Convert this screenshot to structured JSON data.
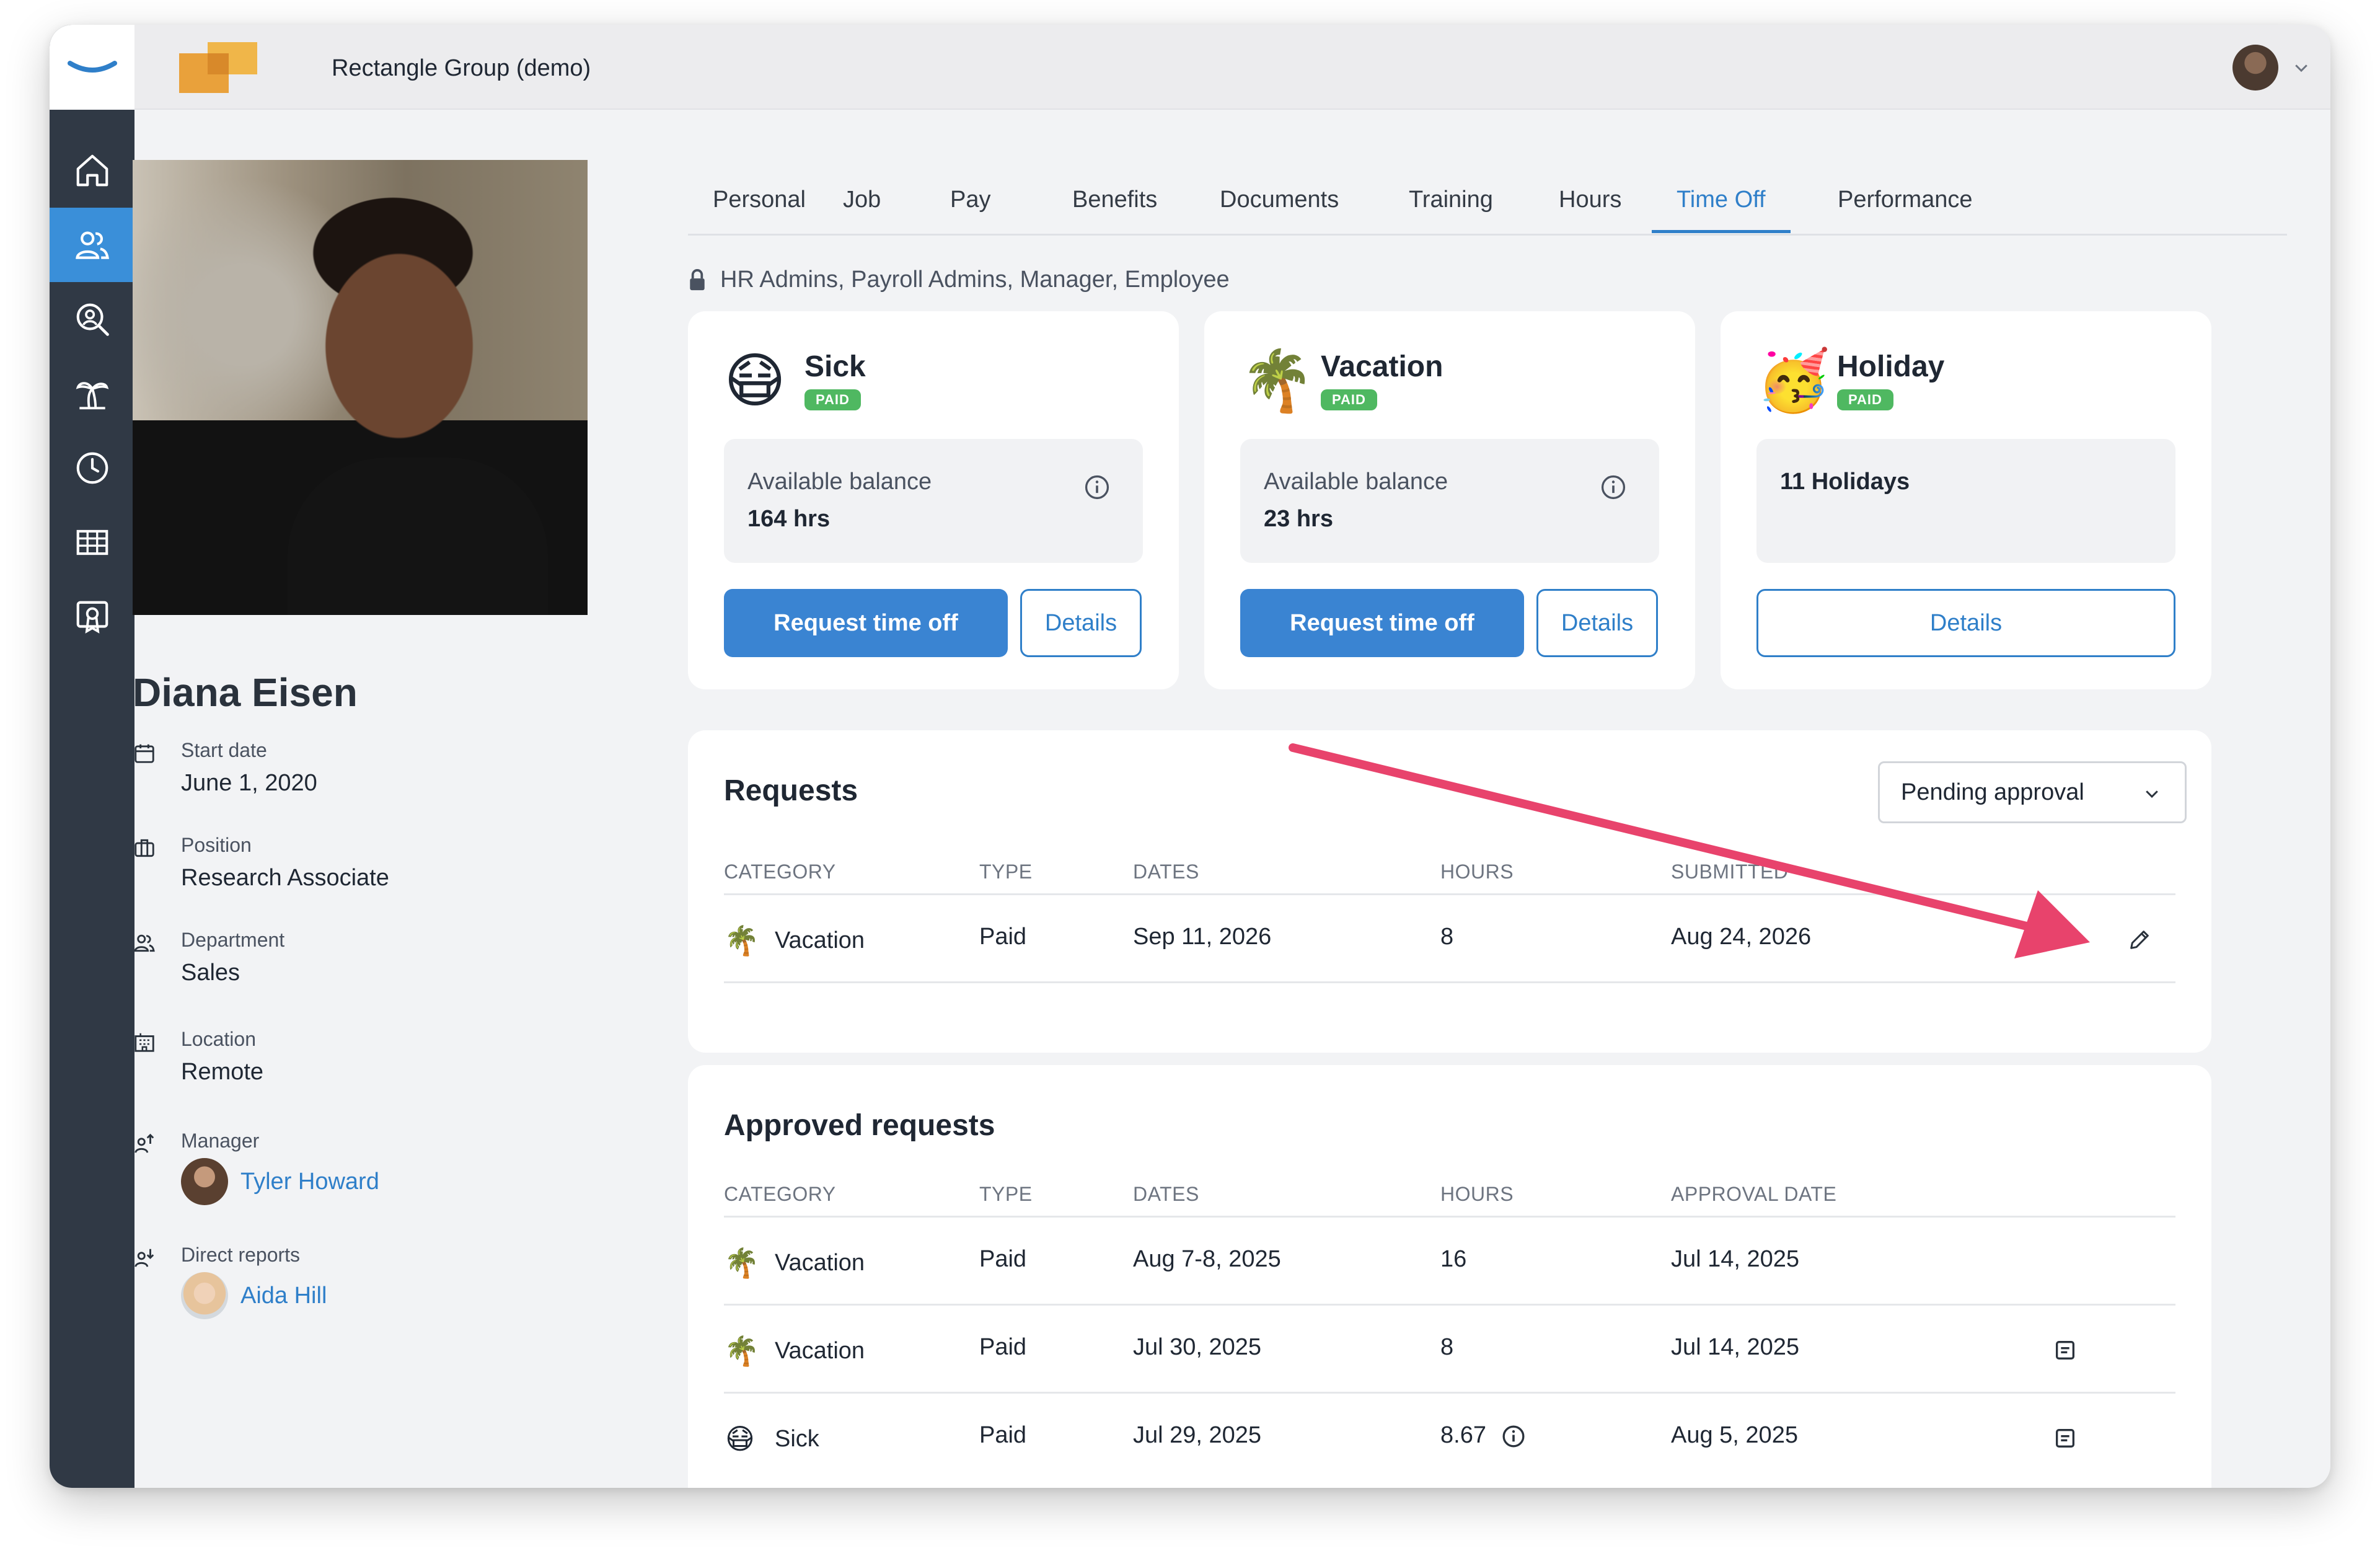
{
  "company": {
    "name": "Rectangle Group (demo)"
  },
  "sidebar": {
    "items": [
      {
        "label": "home",
        "icon": "home-icon"
      },
      {
        "label": "people",
        "icon": "people-icon",
        "active": true
      },
      {
        "label": "search",
        "icon": "user-search-icon"
      },
      {
        "label": "time off",
        "icon": "palm-tree-icon"
      },
      {
        "label": "time",
        "icon": "clock-icon"
      },
      {
        "label": "reports",
        "icon": "table-icon"
      },
      {
        "label": "training",
        "icon": "certificate-icon"
      }
    ]
  },
  "profile": {
    "name": "Diana Eisen",
    "start_date_label": "Start date",
    "start_date": "June 1, 2020",
    "position_label": "Position",
    "position": "Research Associate",
    "department_label": "Department",
    "department": "Sales",
    "location_label": "Location",
    "location": "Remote",
    "manager_label": "Manager",
    "manager": "Tyler Howard",
    "direct_reports_label": "Direct reports",
    "direct_report": "Aida Hill"
  },
  "tabs": [
    "Personal",
    "Job",
    "Pay",
    "Benefits",
    "Documents",
    "Training",
    "Hours",
    "Time Off",
    "Performance"
  ],
  "active_tab": "Time Off",
  "permissions": "HR Admins, Payroll Admins, Manager, Employee",
  "policies": [
    {
      "title": "Sick",
      "badge": "PAID",
      "emoji": "😷",
      "balance_label": "Available balance",
      "balance": "164 hrs",
      "request_label": "Request time off",
      "details_label": "Details"
    },
    {
      "title": "Vacation",
      "badge": "PAID",
      "emoji": "🌴",
      "balance_label": "Available balance",
      "balance": "23 hrs",
      "request_label": "Request time off",
      "details_label": "Details"
    },
    {
      "title": "Holiday",
      "badge": "PAID",
      "emoji": "🥳",
      "summary": "11 Holidays",
      "details_label": "Details"
    }
  ],
  "requests": {
    "title": "Requests",
    "filter": "Pending approval",
    "headers": [
      "CATEGORY",
      "TYPE",
      "DATES",
      "HOURS",
      "SUBMITTED"
    ],
    "rows": [
      {
        "emoji": "🌴",
        "category": "Vacation",
        "type": "Paid",
        "dates": "Sep 11, 2026",
        "hours": "8",
        "submitted": "Aug 24, 2026"
      }
    ]
  },
  "approved": {
    "title": "Approved requests",
    "headers": [
      "CATEGORY",
      "TYPE",
      "DATES",
      "HOURS",
      "APPROVAL DATE"
    ],
    "rows": [
      {
        "emoji": "🌴",
        "category": "Vacation",
        "type": "Paid",
        "dates": "Aug 7-8, 2025",
        "hours": "16",
        "approval_date": "Jul 14, 2025"
      },
      {
        "emoji": "🌴",
        "category": "Vacation",
        "type": "Paid",
        "dates": "Jul 30, 2025",
        "hours": "8",
        "approval_date": "Jul 14, 2025"
      },
      {
        "emoji": "😷",
        "category": "Sick",
        "type": "Paid",
        "dates": "Jul 29, 2025",
        "hours": "8.67",
        "approval_date": "Aug 5, 2025"
      }
    ]
  },
  "colors": {
    "accent": "#2f7fc9",
    "sidebar": "#303945",
    "badge": "#4fb861",
    "arrow": "#e8436c"
  }
}
